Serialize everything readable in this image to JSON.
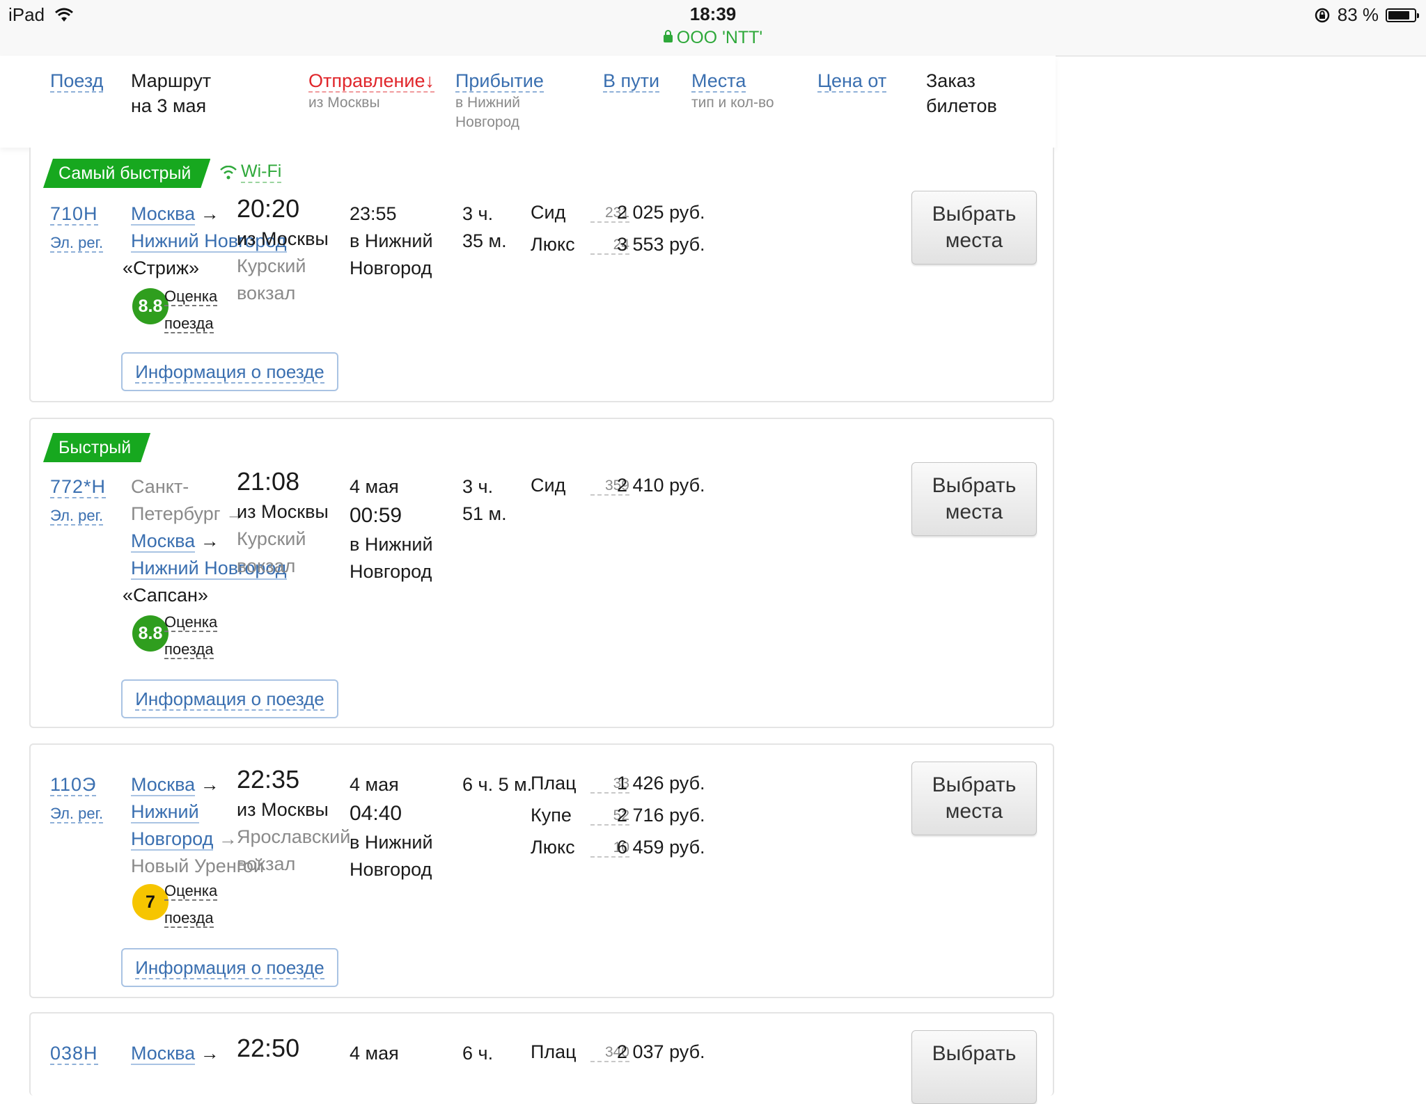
{
  "status_bar": {
    "device": "iPad",
    "time": "18:39",
    "site": "ООО 'NTT'",
    "battery": "83 %",
    "battery_level": 0.83
  },
  "header": {
    "train": "Поезд",
    "route_1": "Маршрут",
    "route_2": "на 3 мая",
    "departure": "Отправление",
    "departure_arrow": "↓",
    "departure_sub": "из Москвы",
    "arrival": "Прибытие",
    "arrival_sub_1": "в Нижний",
    "arrival_sub_2": "Новгород",
    "duration": "В пути",
    "seats": "Места",
    "seats_sub": "тип и кол-во",
    "price": "Цена от",
    "order_1": "Заказ",
    "order_2": "билетов"
  },
  "common": {
    "arrow": "→",
    "rating_1": "Оценка",
    "rating_2": "поезда",
    "info_button": "Информация о поезде",
    "select_1": "Выбрать",
    "select_2": "места",
    "wifi": "Wi-Fi",
    "train_class": "Эл. рег."
  },
  "colors": {
    "badge_green": "#17a81f",
    "rating_green": "#2f9e1e",
    "rating_yellow": "#f6c500",
    "link_blue": "#3a6fb0",
    "active_red": "#e0262b"
  },
  "trains": [
    {
      "badge": "Самый быстрый",
      "number": "710Н",
      "route_1": "Москва",
      "route_2": "Нижний Новгород",
      "name": "«Стриж»",
      "dep_time": "20:20",
      "dep_from": "из Москвы",
      "dep_station_1": "Курский",
      "dep_station_2": "вокзал",
      "arr_time": "23:55",
      "arr_to_1": "в Нижний",
      "arr_to_2": "Новгород",
      "duration_1": "3 ч.",
      "duration_2": "35 м.",
      "rating": "8.8",
      "seats": [
        {
          "type": "Сид",
          "count": "231",
          "price": "2 025 руб."
        },
        {
          "type": "Люкс",
          "count": "24",
          "price": "3 553 руб."
        }
      ]
    },
    {
      "badge": "Быстрый",
      "number": "772*Н",
      "origin_1": "Санкт-",
      "origin_2": "Петербург",
      "route_1": "Москва",
      "route_2": "Нижний Новгород",
      "name": "«Сапсан»",
      "dep_time": "21:08",
      "dep_from": "из Москвы",
      "dep_station_1": "Курский",
      "dep_station_2": "вокзал",
      "arr_date": "4 мая",
      "arr_time": "00:59",
      "arr_to_1": "в Нижний",
      "arr_to_2": "Новгород",
      "duration_1": "3 ч.",
      "duration_2": "51 м.",
      "rating": "8.8",
      "seats": [
        {
          "type": "Сид",
          "count": "359",
          "price": "2 410 руб."
        }
      ]
    },
    {
      "number": "110Э",
      "route_1": "Москва",
      "route_2a": "Нижний",
      "route_2b": "Новгород",
      "route_3": "Новый Уренгой",
      "dep_time": "22:35",
      "dep_from": "из Москвы",
      "dep_station_1": "Ярославский",
      "dep_station_2": "вокзал",
      "arr_date": "4 мая",
      "arr_time": "04:40",
      "arr_to_1": "в Нижний",
      "arr_to_2": "Новгород",
      "duration_1": "6 ч. 5 м.",
      "rating": "7",
      "seats": [
        {
          "type": "Плац",
          "count": "33",
          "price": "1 426 руб."
        },
        {
          "type": "Купе",
          "count": "52",
          "price": "2 716 руб."
        },
        {
          "type": "Люкс",
          "count": "10",
          "price": "6 459 руб."
        }
      ]
    },
    {
      "number": "038Н",
      "route_1": "Москва",
      "dep_time": "22:50",
      "arr_date": "4 мая",
      "duration_1": "6 ч.",
      "seats": [
        {
          "type": "Плац",
          "count": "340",
          "price": "2 037 руб."
        }
      ]
    }
  ]
}
